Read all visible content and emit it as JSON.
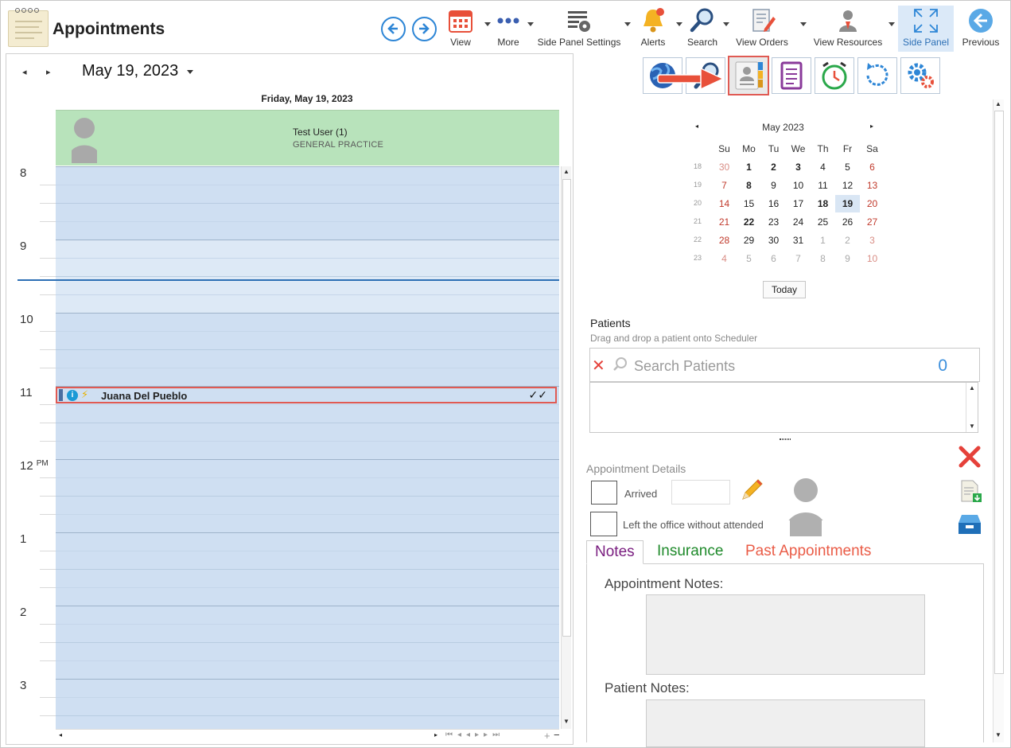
{
  "header": {
    "title": "Appointments",
    "toolbar": {
      "view": "View",
      "more": "More",
      "side_panel_settings": "Side Panel Settings",
      "alerts": "Alerts",
      "search": "Search",
      "view_orders": "View Orders",
      "view_resources": "View Resources",
      "side_panel": "Side Panel",
      "previous": "Previous"
    }
  },
  "scheduler": {
    "date": "May 19, 2023",
    "day_heading": "Friday, May 19, 2023",
    "resource_name": "Test User (1)",
    "resource_dept": "GENERAL PRACTICE",
    "hours": [
      "8",
      "9",
      "10",
      "11",
      "12",
      "1",
      "2",
      "3"
    ],
    "pm_marker": "PM",
    "appointment": {
      "name": "Juana Del Pueblo",
      "info_icon": "i",
      "status": "✓✓"
    }
  },
  "calendar": {
    "title": "May 2023",
    "dow": [
      "Su",
      "Mo",
      "Tu",
      "We",
      "Th",
      "Fr",
      "Sa"
    ],
    "weeks": [
      "18",
      "19",
      "20",
      "21",
      "22",
      "23"
    ],
    "days": [
      [
        "30",
        "1",
        "2",
        "3",
        "4",
        "5",
        "6"
      ],
      [
        "7",
        "8",
        "9",
        "10",
        "11",
        "12",
        "13"
      ],
      [
        "14",
        "15",
        "16",
        "17",
        "18",
        "19",
        "20"
      ],
      [
        "21",
        "22",
        "23",
        "24",
        "25",
        "26",
        "27"
      ],
      [
        "28",
        "29",
        "30",
        "31",
        "1",
        "2",
        "3"
      ],
      [
        "4",
        "5",
        "6",
        "7",
        "8",
        "9",
        "10"
      ]
    ],
    "selected": "19",
    "today_button": "Today"
  },
  "patients": {
    "title": "Patients",
    "hint": "Drag and drop a patient onto Scheduler",
    "search_placeholder": "Search Patients",
    "count": "0"
  },
  "details": {
    "title": "Appointment Details",
    "arrived": "Arrived",
    "left_office": "Left the office without attended",
    "tabs": [
      "Notes",
      "Insurance",
      "Past Appointments"
    ],
    "appointment_notes_label": "Appointment Notes:",
    "patient_notes_label": "Patient Notes:"
  },
  "colors": {
    "accent_blue": "#2c6fb5",
    "resource_green": "#b8e3bb",
    "grid_blue": "#cfdff2",
    "highlight_red": "#e05a53",
    "notes_tab": "#7a1e80",
    "insurance_tab": "#1f8a2b",
    "past_tab": "#ea5c47"
  },
  "icons": [
    "calendar-icon",
    "more-dots-icon",
    "settings-icon",
    "bell-icon",
    "search-icon",
    "orders-icon",
    "resources-icon",
    "expand-icon",
    "back-icon"
  ]
}
